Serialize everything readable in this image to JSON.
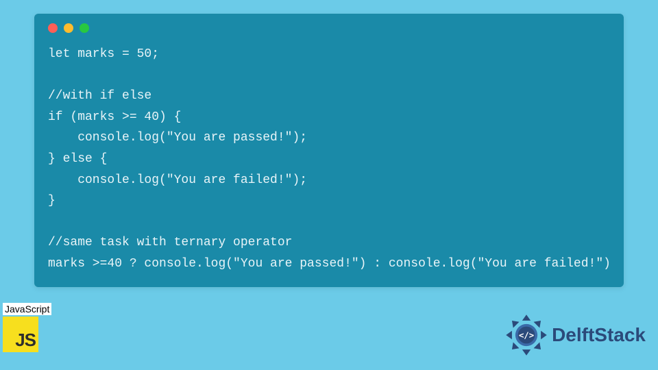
{
  "window": {
    "dots": {
      "red": "#ff5f57",
      "yellow": "#febc2e",
      "green": "#28c840"
    }
  },
  "code": {
    "lines": [
      "let marks = 50;",
      "",
      "//with if else",
      "if (marks >= 40) {",
      "    console.log(\"You are passed!\");",
      "} else {",
      "    console.log(\"You are failed!\");",
      "}",
      "",
      "//same task with ternary operator",
      "marks >=40 ? console.log(\"You are passed!\") : console.log(\"You are failed!\")"
    ]
  },
  "badge": {
    "label": "JavaScript",
    "logo_text": "JS"
  },
  "brand": {
    "name": "DelftStack"
  }
}
